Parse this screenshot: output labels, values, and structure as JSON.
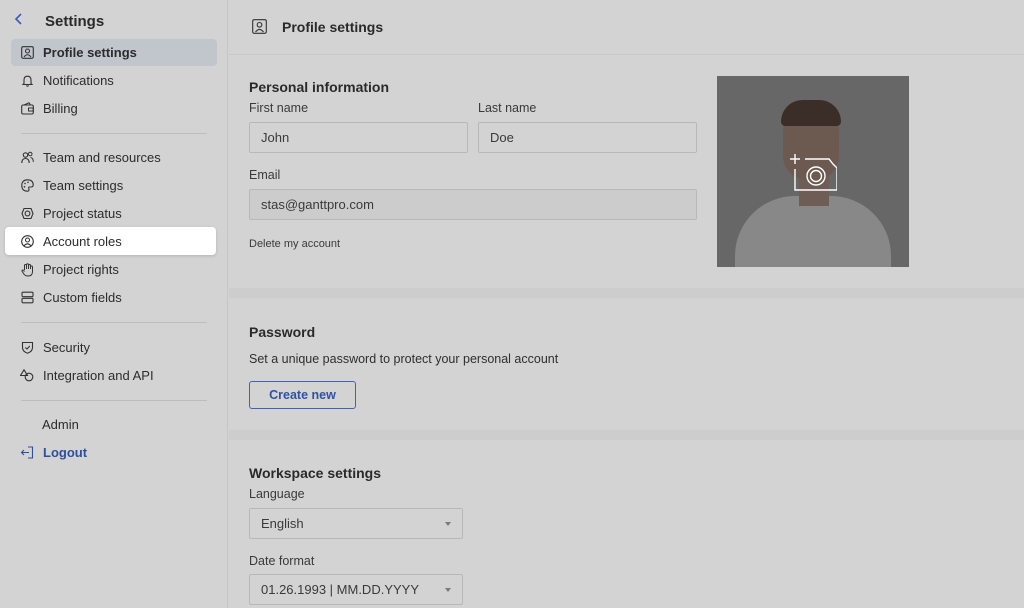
{
  "sidebar": {
    "back_icon": "chevron-left-icon",
    "title": "Settings",
    "items": [
      {
        "label": "Profile settings",
        "icon": "profile-icon",
        "state": "active"
      },
      {
        "label": "Notifications",
        "icon": "bell-icon"
      },
      {
        "label": "Billing",
        "icon": "wallet-icon"
      },
      {
        "label": "Team and resources",
        "icon": "people-icon"
      },
      {
        "label": "Team settings",
        "icon": "palette-icon"
      },
      {
        "label": "Project status",
        "icon": "status-icon"
      },
      {
        "label": "Account roles",
        "icon": "user-circle-icon",
        "state": "highlighted"
      },
      {
        "label": "Project rights",
        "icon": "hand-icon"
      },
      {
        "label": "Custom fields",
        "icon": "fields-icon"
      },
      {
        "label": "Security",
        "icon": "shield-icon"
      },
      {
        "label": "Integration and API",
        "icon": "shapes-icon"
      },
      {
        "label": "Admin",
        "icon": ""
      },
      {
        "label": "Logout",
        "icon": "logout-icon"
      }
    ]
  },
  "header": {
    "icon": "profile-icon",
    "title": "Profile settings"
  },
  "personal": {
    "heading": "Personal information",
    "first_name_label": "First name",
    "first_name_value": "John",
    "last_name_label": "Last name",
    "last_name_value": "Doe",
    "email_label": "Email",
    "email_value": "stas@ganttpro.com",
    "delete_link": "Delete my account",
    "avatar_icon": "add-photo-icon"
  },
  "password": {
    "heading": "Password",
    "description": "Set a unique password to protect your personal account",
    "button": "Create new"
  },
  "workspace": {
    "heading": "Workspace settings",
    "language_label": "Language",
    "language_value": "English",
    "date_format_label": "Date format",
    "date_format_value": "01.26.1993 | MM.DD.YYYY"
  },
  "colors": {
    "accent": "#2f52a6",
    "overlay_bg": "#d3d3d3",
    "highlight": "#ffffff"
  }
}
